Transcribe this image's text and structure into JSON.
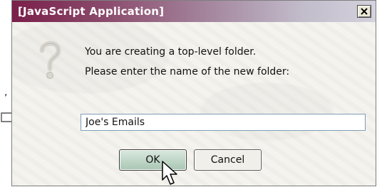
{
  "dialog": {
    "title": "[JavaScript Application]",
    "close_icon": "close-x-icon",
    "message_line1": "You are creating a top-level folder.",
    "message_line2": "Please enter the name of the new folder:",
    "icon": "question-icon",
    "folder_name_value": "Joe's Emails",
    "ok_label": "OK",
    "cancel_label": "Cancel"
  },
  "left_fragment": {
    "comma": ","
  },
  "colors": {
    "title_gradient_start": "#7a1f4a",
    "title_gradient_end": "#d4d2dd",
    "ok_button": "#b8d4c2"
  }
}
